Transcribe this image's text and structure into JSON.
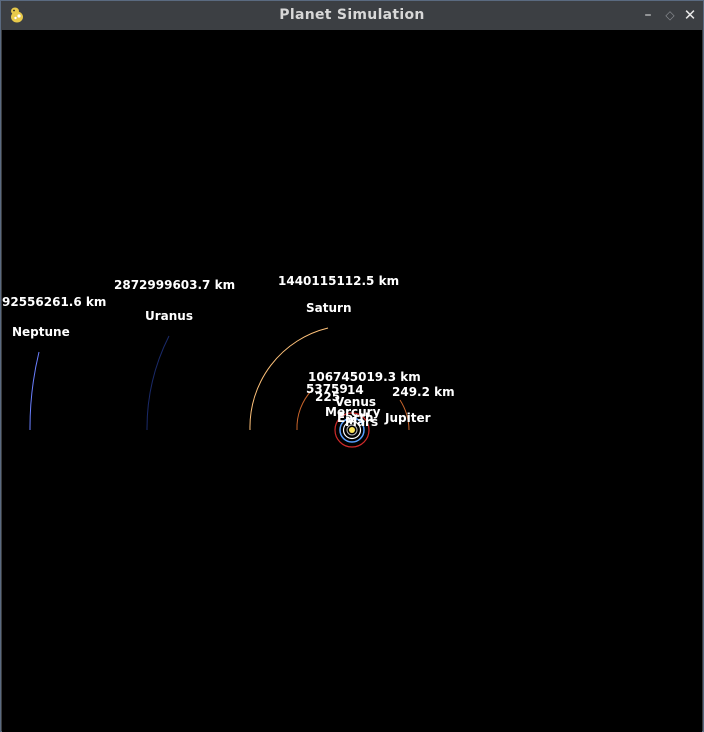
{
  "window": {
    "title": "Planet Simulation",
    "controls": {
      "minimize": "–",
      "maximize": "◇",
      "close": "✕"
    }
  },
  "planets": [
    {
      "name": "Neptune",
      "distance": "92556261.6 km",
      "color": "#6a7fff"
    },
    {
      "name": "Uranus",
      "distance": "2872999603.7 km",
      "color": "#1a2a6a"
    },
    {
      "name": "Saturn",
      "distance": "1440115112.5 km",
      "color": "#ffc27a"
    },
    {
      "name": "Jupiter",
      "distance": "249.2 km",
      "color": "#c8642a"
    },
    {
      "name": "Mars",
      "distance": "225",
      "color": "#d02a2a"
    },
    {
      "name": "Earth",
      "distance": "14",
      "color": "#5aa0ff"
    },
    {
      "name": "Venus",
      "distance": "106745019.3 km",
      "color": "#ffffff"
    },
    {
      "name": "Mercury",
      "distance": "53759",
      "color": "#aaaaaa"
    }
  ]
}
